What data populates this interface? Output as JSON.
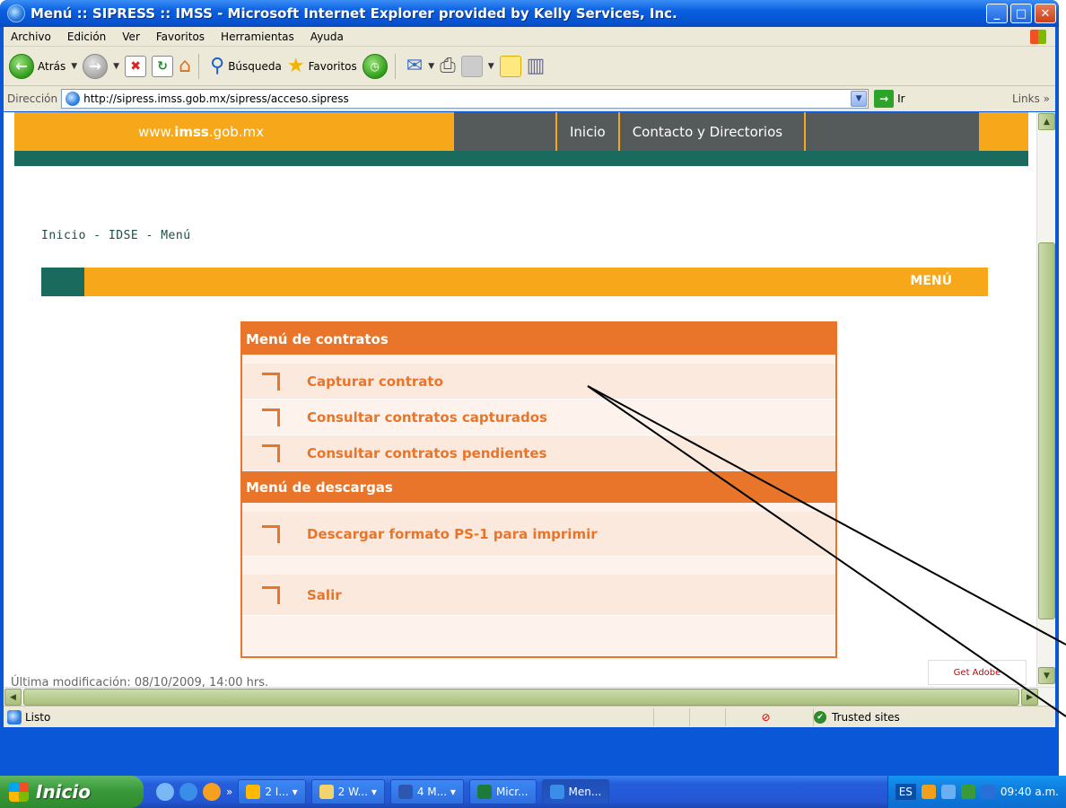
{
  "window": {
    "title": "Menú :: SIPRESS :: IMSS - Microsoft Internet Explorer provided by Kelly Services, Inc.",
    "controls": {
      "minimize": "_",
      "maximize": "□",
      "close": "✕"
    }
  },
  "menubar": {
    "items": [
      "Archivo",
      "Edición",
      "Ver",
      "Favoritos",
      "Herramientas",
      "Ayuda"
    ]
  },
  "toolbar": {
    "back_label": "Atrás",
    "search_label": "Búsqueda",
    "favorites_label": "Favoritos"
  },
  "address": {
    "label": "Dirección",
    "url": "http://sipress.imss.gob.mx/sipress/acceso.sipress",
    "go_label": "Ir",
    "links_label": "Links"
  },
  "site": {
    "domain_prefix": "www.",
    "domain_bold": "imss",
    "domain_suffix": ".gob.mx",
    "nav": [
      "Inicio",
      "Contacto y Directorios"
    ],
    "breadcrumb": "Inicio - IDSE - Menú",
    "band_title": "MENÚ",
    "sections": [
      {
        "title": "Menú de contratos",
        "items": [
          "Capturar contrato",
          "Consultar contratos capturados",
          "Consultar contratos pendientes"
        ]
      },
      {
        "title": "Menú de descargas",
        "items": [
          "Descargar formato PS-1 para imprimir",
          "Salir"
        ]
      }
    ],
    "footer": "Última modificación: 08/10/2009, 14:00 hrs.",
    "adobe_badge": "Get Adobe"
  },
  "statusbar": {
    "status": "Listo",
    "zone": "Trusted sites"
  },
  "taskbar": {
    "start_label": "Inicio",
    "tasks": [
      "2 I...",
      "2 W...",
      "4 M...",
      "Micr...",
      "Men..."
    ],
    "language": "ES",
    "clock": "09:40 a.m."
  }
}
